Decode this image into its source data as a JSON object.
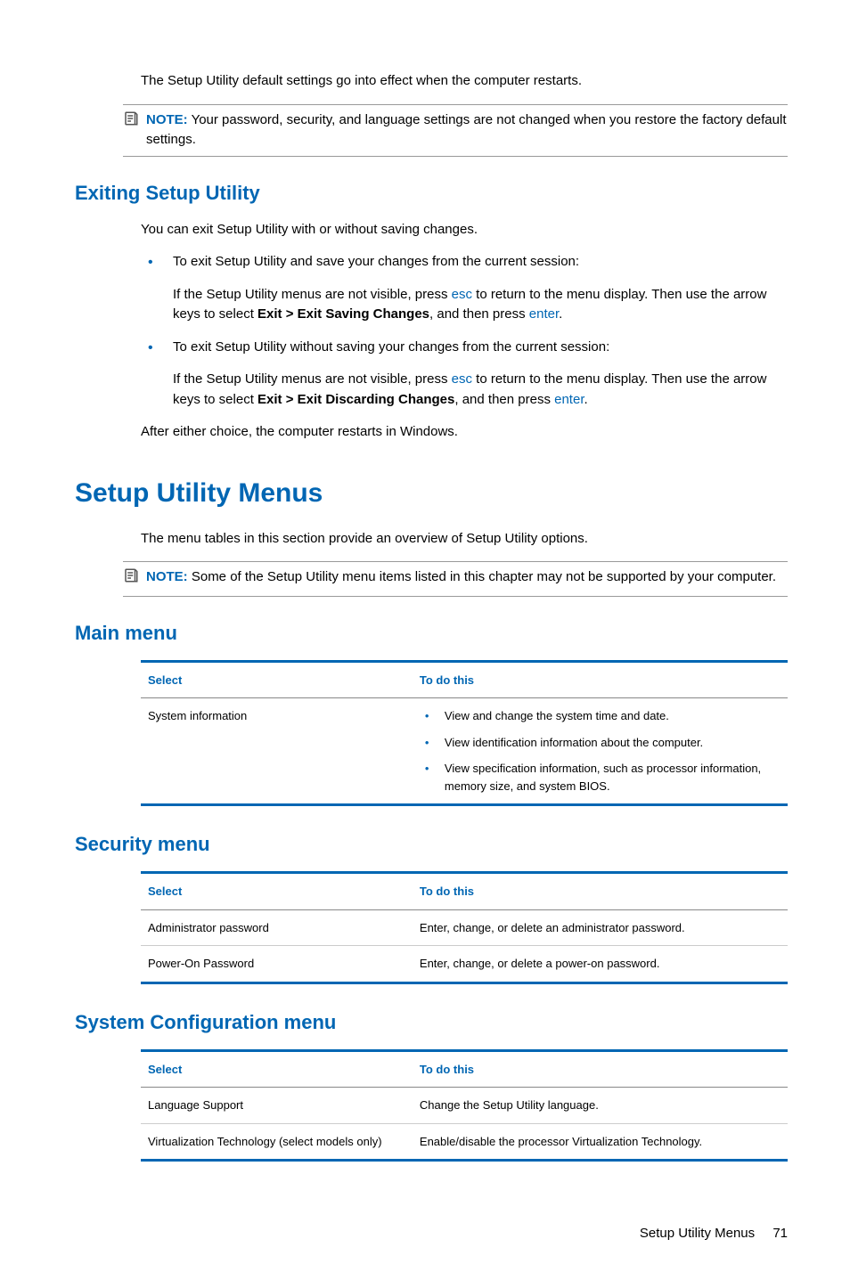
{
  "intro1": "The Setup Utility default settings go into effect when the computer restarts.",
  "note1": {
    "label": "NOTE:",
    "text": "Your password, security, and language settings are not changed when you restore the factory default settings."
  },
  "h_exit": "Exiting Setup Utility",
  "exit_intro": "You can exit Setup Utility with or without saving changes.",
  "exit_b1": "To exit Setup Utility and save your changes from the current session:",
  "exit_b1_p1a": "If the Setup Utility menus are not visible, press ",
  "exit_esc": "esc",
  "exit_b1_p1b": " to return to the menu display. Then use the arrow keys to select ",
  "exit_b1_bold": "Exit > Exit Saving Changes",
  "exit_b1_p1c": ", and then press ",
  "exit_enter": "enter",
  "exit_period": ".",
  "exit_b2": "To exit Setup Utility without saving your changes from the current session:",
  "exit_b2_p1a": "If the Setup Utility menus are not visible, press ",
  "exit_b2_p1b": " to return to the menu display. Then use the arrow keys to select ",
  "exit_b2_bold": "Exit > Exit Discarding Changes",
  "exit_b2_p1c": ", and then press ",
  "exit_after": "After either choice, the computer restarts in Windows.",
  "h_menus": "Setup Utility Menus",
  "menus_intro": "The menu tables in this section provide an overview of Setup Utility options.",
  "note2": {
    "label": "NOTE:",
    "text": "Some of the Setup Utility menu items listed in this chapter may not be supported by your computer."
  },
  "h_main": "Main menu",
  "th_select": "Select",
  "th_todo": "To do this",
  "main_r1": "System information",
  "main_r1_b1": "View and change the system time and date.",
  "main_r1_b2": "View identification information about the computer.",
  "main_r1_b3": "View specification information, such as processor information, memory size, and system BIOS.",
  "h_security": "Security menu",
  "sec_r1a": "Administrator password",
  "sec_r1b": "Enter, change, or delete an administrator password.",
  "sec_r2a": "Power-On Password",
  "sec_r2b": "Enter, change, or delete a power-on password.",
  "h_syscfg": "System Configuration menu",
  "sys_r1a": "Language Support",
  "sys_r1b": "Change the Setup Utility language.",
  "sys_r2a": "Virtualization Technology (select models only)",
  "sys_r2b": "Enable/disable the processor Virtualization Technology.",
  "footer_text": "Setup Utility Menus",
  "footer_page": "71"
}
